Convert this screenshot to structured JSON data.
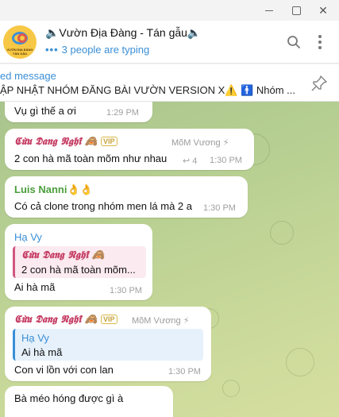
{
  "header": {
    "title": "🔈Vườn Địa Đàng - Tán gẫu🔈",
    "typing_dots": "•••",
    "typing": "3 people are typing",
    "avatar_text": "VƯỜN ĐỊA ĐÀNG TÁN GẪU"
  },
  "pinned": {
    "label": "ed message",
    "text": "ẬP NHẬT NHÓM ĐĂNG BÀI VƯỜN VERSION X⚠️ 🚹 Nhóm ..."
  },
  "messages": {
    "m1": {
      "text": "Vụ gì thế a ơi",
      "time": "1:29 PM"
    },
    "m2": {
      "sender": "𝕮𝖚̛̀𝖚 𝕯𝖆𝖓𝖌 𝕹𝖌𝖍𝖎̃ 🙈",
      "badge": "VIP",
      "role": "MõM Vương",
      "text": "2 con hà mã toàn mõm như nhau",
      "forwards": "↩ 4",
      "time": "1:30 PM"
    },
    "m3": {
      "sender": "Luis Nanni👌👌",
      "text": "Có cả clone trong nhóm men lá mà 2 a",
      "time": "1:30 PM"
    },
    "m4": {
      "sender": "Hạ Vy",
      "reply_name": "𝕮𝖚̛̀𝖚 𝕯𝖆𝖓𝖌 𝕹𝖌𝖍𝖎̃ 🙈",
      "reply_text": "2 con hà mã toàn mõm...",
      "text": "Ai hà mã",
      "time": "1:30 PM"
    },
    "m5": {
      "sender": "𝕮𝖚̛̀𝖚 𝕯𝖆𝖓𝖌 𝕹𝖌𝖍𝖎̃ 🙈",
      "badge": "VIP",
      "role": "MõM Vương",
      "reply_name": "Hạ Vy",
      "reply_text": "Ai hà mã",
      "text": "Con vi lồn với con lan",
      "time": "1:30 PM"
    },
    "m6": {
      "text": "Bà méo hóng được gì à"
    }
  }
}
